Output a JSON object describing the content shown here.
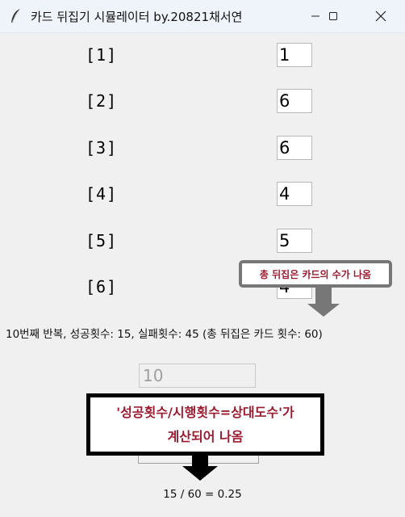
{
  "window": {
    "title": "카드 뒤집기 시뮬레이터 by.20821채서연",
    "icon": "feather-icon",
    "controls": [
      "minimize-icon",
      "maximize-icon",
      "close-icon"
    ]
  },
  "rows": [
    {
      "label": "[1]",
      "value": "1"
    },
    {
      "label": "[2]",
      "value": "6"
    },
    {
      "label": "[3]",
      "value": "6"
    },
    {
      "label": "[4]",
      "value": "4"
    },
    {
      "label": "[5]",
      "value": "5"
    },
    {
      "label": "[6]",
      "value": "4"
    }
  ],
  "status": "10번째 반복, 성공횟수: 15, 실패횟수: 45 (총 뒤집은 카드 횟수: 60)",
  "iteration_input": {
    "value": "10"
  },
  "annotations": {
    "top": "총 뒤집은 카드의 수가 나옴",
    "bottom_line1": "'성공횟수/시행횟수=상대도수'가",
    "bottom_line2": "계산되어 나옴"
  },
  "result": "15 / 60 = 0.25",
  "colors": {
    "background": "#f0f0f0",
    "titlebar": "#eef4f9",
    "annotation_text": "#9b1b30"
  }
}
